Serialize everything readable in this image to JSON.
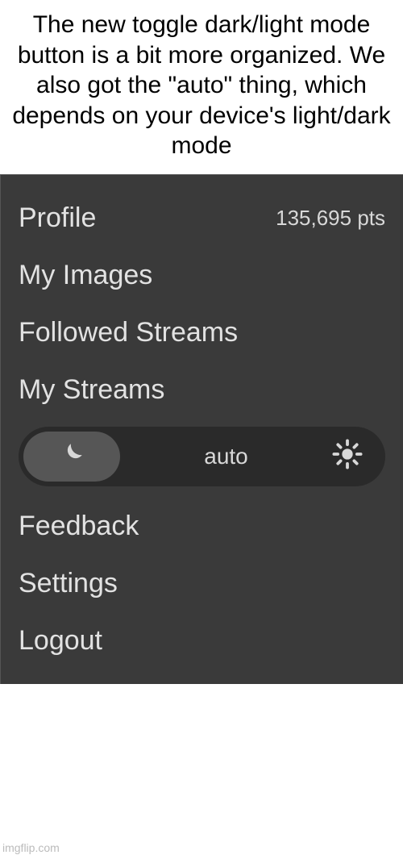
{
  "caption": "The new toggle dark/light mode button is a bit more organized. We also got the \"auto\" thing, which depends on your device's light/dark mode",
  "menu": {
    "profile": "Profile",
    "points": "135,695 pts",
    "my_images": "My Images",
    "followed_streams": "Followed Streams",
    "my_streams": "My Streams",
    "feedback": "Feedback",
    "settings": "Settings",
    "logout": "Logout"
  },
  "theme_toggle": {
    "auto_label": "auto",
    "selected": "dark"
  },
  "watermark": "imgflip.com"
}
